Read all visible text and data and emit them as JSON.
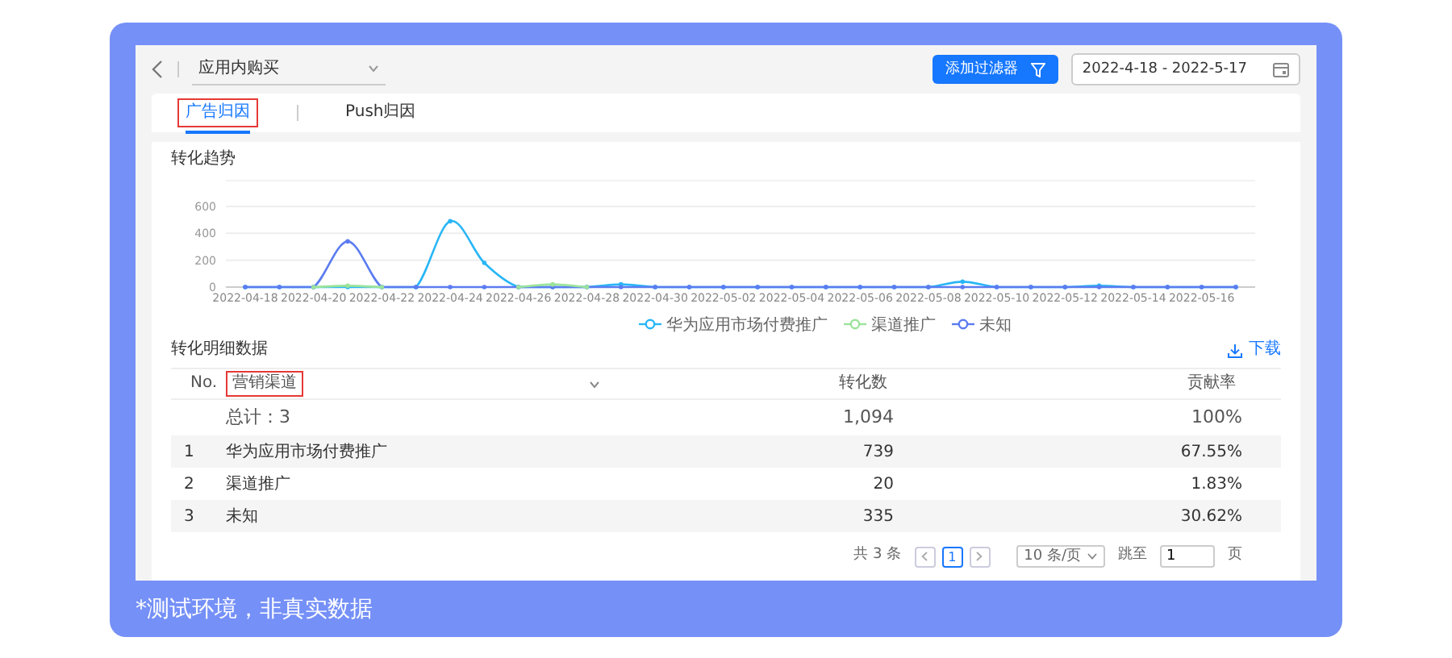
{
  "header": {
    "title": "应用内购买",
    "filter_button": "添加过滤器",
    "date_range": "2022-4-18 - 2022-5-17"
  },
  "tabs": [
    {
      "label": "广告归因",
      "selected": true,
      "highlighted": true
    },
    {
      "label": "Push归因",
      "selected": false,
      "highlighted": false
    }
  ],
  "trend": {
    "title": "转化趋势",
    "chart_data": {
      "type": "line",
      "categories": [
        "2022-04-18",
        null,
        "2022-04-20",
        null,
        "2022-04-22",
        null,
        "2022-04-24",
        null,
        "2022-04-26",
        null,
        "2022-04-28",
        null,
        "2022-04-30",
        null,
        "2022-05-02",
        null,
        "2022-05-04",
        null,
        "2022-05-06",
        null,
        "2022-05-08",
        null,
        "2022-05-10",
        null,
        "2022-05-12",
        null,
        "2022-05-14",
        null,
        "2022-05-16",
        null
      ],
      "legend": true,
      "yticks": [
        0,
        200,
        400,
        600
      ],
      "ylim": [
        0,
        600
      ],
      "series": [
        {
          "name": "华为应用市场付费推广",
          "color": "#29b6f6",
          "values": [
            0,
            0,
            0,
            0,
            0,
            0,
            490,
            180,
            0,
            0,
            0,
            20,
            0,
            0,
            0,
            0,
            0,
            0,
            0,
            0,
            0,
            40,
            0,
            0,
            0,
            10,
            0,
            0,
            0,
            0
          ]
        },
        {
          "name": "渠道推广",
          "color": "#9be39b",
          "values": [
            null,
            null,
            0,
            10,
            0,
            null,
            null,
            null,
            0,
            20,
            0,
            null,
            null,
            null,
            null,
            null,
            null,
            null,
            null,
            null,
            null,
            null,
            null,
            null,
            null,
            null,
            null,
            null,
            null,
            null
          ]
        },
        {
          "name": "未知",
          "color": "#5b7cf0",
          "values": [
            0,
            0,
            0,
            340,
            0,
            0,
            0,
            0,
            0,
            0,
            0,
            0,
            0,
            0,
            0,
            0,
            0,
            0,
            0,
            0,
            0,
            0,
            0,
            0,
            0,
            0,
            0,
            0,
            0,
            0
          ]
        }
      ]
    }
  },
  "detail": {
    "title": "转化明细数据",
    "download": "下载",
    "columns": [
      {
        "label": "No.",
        "highlighted": false,
        "dropdown": false
      },
      {
        "label": "营销渠道",
        "highlighted": true,
        "dropdown": true
      },
      {
        "label": "转化数",
        "highlighted": false,
        "dropdown": false
      },
      {
        "label": "贡献率",
        "highlighted": false,
        "dropdown": false
      }
    ],
    "total": {
      "label": "总计：3",
      "conversions": "1,094",
      "share": "100%"
    },
    "rows": [
      {
        "no": "1",
        "channel": "华为应用市场付费推广",
        "conversions": "739",
        "share": "67.55%"
      },
      {
        "no": "2",
        "channel": "渠道推广",
        "conversions": "20",
        "share": "1.83%"
      },
      {
        "no": "3",
        "channel": "未知",
        "conversions": "335",
        "share": "30.62%"
      }
    ]
  },
  "pagination": {
    "total": "共 3 条",
    "pages": [
      {
        "label": "1",
        "selected": true
      }
    ],
    "page_size": "10 条/页",
    "jump_label": "跳至",
    "jump_value": "1",
    "page_unit": "页"
  },
  "caption": "*测试环境，非真实数据"
}
